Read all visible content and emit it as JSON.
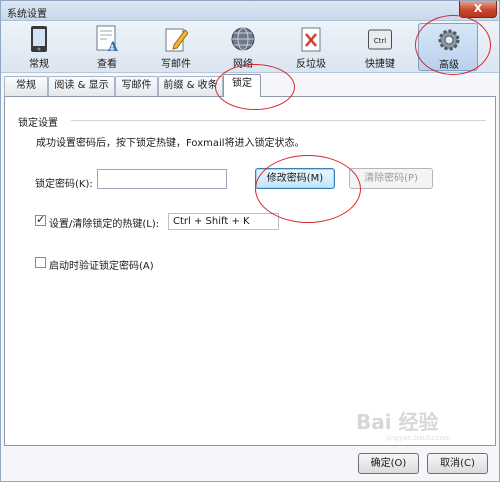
{
  "window": {
    "title": "系统设置",
    "close_symbol": "X"
  },
  "toolbar": {
    "items": [
      {
        "label": "常规",
        "icon": "phone-icon"
      },
      {
        "label": "查看",
        "icon": "document-font-icon"
      },
      {
        "label": "写邮件",
        "icon": "pencil-icon"
      },
      {
        "label": "网络",
        "icon": "globe-icon"
      },
      {
        "label": "反垃圾",
        "icon": "trash-icon"
      },
      {
        "label": "快捷键",
        "icon": "ctrl-key-icon"
      },
      {
        "label": "高级",
        "icon": "gear-icon"
      }
    ],
    "active_index": 6,
    "ctrl_text": "Ctrl"
  },
  "tabs": [
    {
      "label": "常规"
    },
    {
      "label": "阅读 & 显示"
    },
    {
      "label": "写邮件"
    },
    {
      "label": "前缀 & 收条"
    },
    {
      "label": "锁定"
    }
  ],
  "active_tab": 4,
  "lock": {
    "group_title": "锁定设置",
    "info": "成功设置密码后，按下锁定热键，Foxmail将进入锁定状态。",
    "password_label": "锁定密码(K):",
    "password_value": "",
    "change_password_button": "修改密码(M)",
    "clear_password_button": "清除密码(P)",
    "hotkey_checkbox_label": "设置/清除锁定的热键(L):",
    "hotkey_checked": true,
    "hotkey_value": "Ctrl + Shift + K",
    "verify_on_start_label": "启动时验证锁定密码(A)",
    "verify_on_start_checked": false
  },
  "footer": {
    "ok_button": "确定(O)",
    "cancel_button": "取消(C)"
  },
  "watermark": {
    "text": "Bai 经验",
    "subtext": "jingyan.baidu.com"
  },
  "colors": {
    "annotation_red": "#d9262c",
    "accent_blue": "#3c7fb1"
  }
}
